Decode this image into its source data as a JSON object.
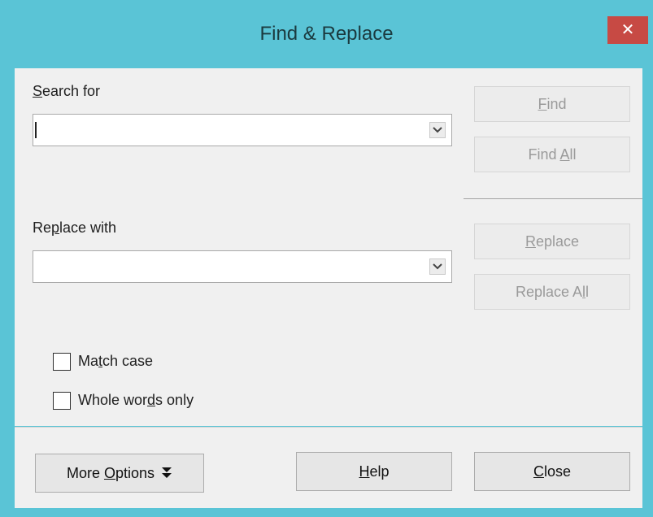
{
  "window": {
    "title": "Find & Replace",
    "close_glyph": "✕"
  },
  "search": {
    "label_prefix": "",
    "label_mnemonic": "S",
    "label_suffix": "earch for",
    "value": ""
  },
  "replace": {
    "label_prefix": "Re",
    "label_mnemonic": "p",
    "label_suffix": "lace with",
    "value": ""
  },
  "side_buttons": {
    "find_mnemonic": "F",
    "find_rest": "ind",
    "find_all_prefix": "Find ",
    "find_all_mnemonic": "A",
    "find_all_suffix": "ll",
    "replace_mnemonic": "R",
    "replace_rest": "eplace",
    "replace_all_prefix": "Replace A",
    "replace_all_mnemonic": "l",
    "replace_all_suffix": "l"
  },
  "options": {
    "match_case_prefix": "Ma",
    "match_case_mnemonic": "t",
    "match_case_suffix": "ch case",
    "match_case_checked": false,
    "whole_words_prefix": "Whole wor",
    "whole_words_mnemonic": "d",
    "whole_words_suffix": "s only",
    "whole_words_checked": false
  },
  "footer": {
    "more_options_prefix": "More ",
    "more_options_mnemonic": "O",
    "more_options_suffix": "ptions",
    "help_mnemonic": "H",
    "help_rest": "elp",
    "close_mnemonic": "C",
    "close_rest": "lose"
  },
  "colors": {
    "titlebar": "#5ac4d6",
    "close_button": "#c74a44",
    "dialog_body": "#f0f0f0"
  },
  "icons": {
    "close": "close-icon",
    "dropdown": "chevron-down-icon",
    "more_options": "double-chevron-down-icon"
  }
}
